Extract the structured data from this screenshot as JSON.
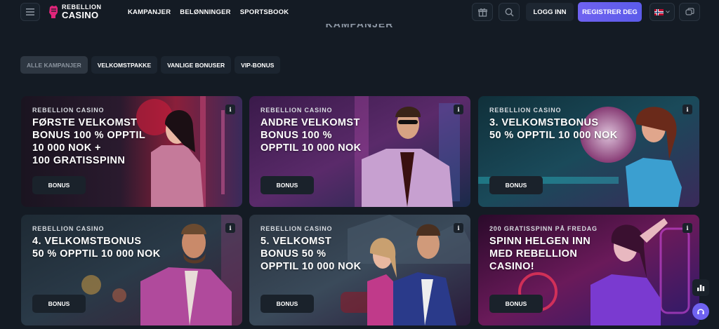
{
  "header": {
    "logo_line1": "REBELLION",
    "logo_line2": "CASINO",
    "nav": [
      "KAMPANJER",
      "BELØNNINGER",
      "SPORTSBOOK"
    ],
    "login_label": "LOGG INN",
    "register_label": "REGISTRER DEG",
    "language": "NO"
  },
  "page_title": "KAMPANJER",
  "filters": [
    "ALLE KAMPANJER",
    "VELKOMSTPAKKE",
    "VANLIGE BONUSER",
    "VIP-BONUS"
  ],
  "cards": [
    {
      "eyebrow": "REBELLION CASINO",
      "title": [
        "FØRSTE VELKOMST",
        "BONUS 100 % OPPTIL",
        "10 000 NOK +",
        "100 GRATISSPINN"
      ],
      "button": "BONUS",
      "info": "i"
    },
    {
      "eyebrow": "REBELLION CASINO",
      "title": [
        "ANDRE VELKOMST",
        "BONUS 100 %",
        "OPPTIL 10 000 NOK"
      ],
      "button": "BONUS",
      "info": "i"
    },
    {
      "eyebrow": "REBELLION CASINO",
      "title": [
        "3. VELKOMSTBONUS",
        "50 % OPPTIL 10 000 NOK"
      ],
      "button": "BONUS",
      "info": "i"
    },
    {
      "eyebrow": "REBELLION CASINO",
      "title": [
        "4. VELKOMSTBONUS",
        "50 % OPPTIL 10 000 NOK"
      ],
      "button": "BONUS",
      "info": "i"
    },
    {
      "eyebrow": "REBELLION CASINO",
      "title": [
        "5. VELKOMST",
        "BONUS 50 %",
        "OPPTIL 10 000 NOK"
      ],
      "button": "BONUS",
      "info": "i"
    },
    {
      "eyebrow": "200 GRATISSPINN PÅ FREDAG",
      "title": [
        "SPINN HELGEN INN",
        "MED REBELLION",
        "CASINO!"
      ],
      "button": "BONUS",
      "info": "i"
    }
  ],
  "colors": {
    "background": "#141b24",
    "accent": "#6f62f0",
    "brand": "#e0257a"
  }
}
